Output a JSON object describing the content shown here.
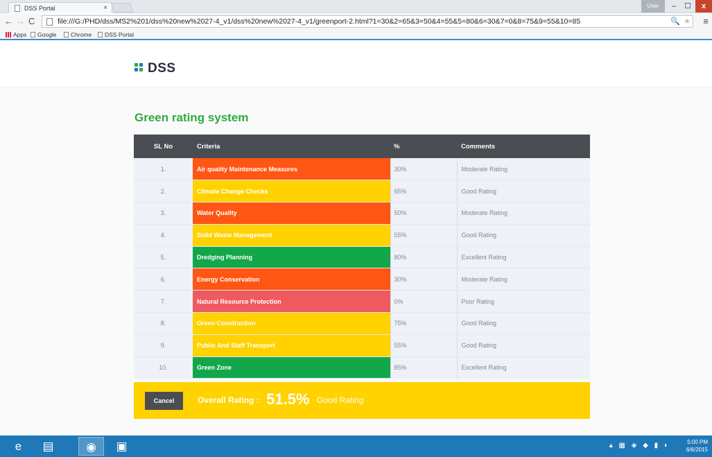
{
  "browser": {
    "tab_title": "DSS Portal",
    "tab_close": "×",
    "window_user": "User",
    "minimize": "–",
    "maximize": "☐",
    "close": "x",
    "back": "←",
    "forward": "→",
    "reload": "C",
    "url": "file:///G:/PHD/dss/MS2%201/dss%20new%2027-4_v1/dss%20new%2027-4_v1/greenport-2.html?1=30&2=65&3=50&4=55&5=80&6=30&7=0&8=75&9=55&10=85",
    "zoom_icon": "🔍",
    "star_icon": "★",
    "menu_icon": "≡",
    "bookmarks": [
      "Apps",
      "Google",
      "Chrome",
      "DSS Portal"
    ]
  },
  "header": {
    "logo_text": "DSS"
  },
  "page": {
    "title": "Green rating system"
  },
  "table": {
    "columns": [
      "SL No",
      "Criteria",
      "%",
      "Comments"
    ],
    "rows": [
      {
        "sl": "1.",
        "criteria": "Air quality Maintenance Measures",
        "percent": "30%",
        "comment": "Moderate Rating",
        "color": "#ff5614"
      },
      {
        "sl": "2.",
        "criteria": "Climate Change Checks",
        "percent": "65%",
        "comment": "Good Rating",
        "color": "#ffd200"
      },
      {
        "sl": "3.",
        "criteria": "Water Quality",
        "percent": "50%",
        "comment": "Moderate Rating",
        "color": "#ff5614"
      },
      {
        "sl": "4.",
        "criteria": "Solid Waste Management",
        "percent": "55%",
        "comment": "Good Rating",
        "color": "#ffd200"
      },
      {
        "sl": "5.",
        "criteria": "Dredging Planning",
        "percent": "80%",
        "comment": "Excellent Rating",
        "color": "#12a74a"
      },
      {
        "sl": "6.",
        "criteria": "Energy Conservation",
        "percent": "30%",
        "comment": "Moderate Rating",
        "color": "#ff5614"
      },
      {
        "sl": "7.",
        "criteria": "Natural Resource Protection",
        "percent": "0%",
        "comment": "Poor Rating",
        "color": "#ee5a5f"
      },
      {
        "sl": "8.",
        "criteria": "Green Construction",
        "percent": "75%",
        "comment": "Good Rating",
        "color": "#ffd200"
      },
      {
        "sl": "9.",
        "criteria": "Public And Staff Transport",
        "percent": "55%",
        "comment": "Good Rating",
        "color": "#ffd200"
      },
      {
        "sl": "10.",
        "criteria": "Green Zone",
        "percent": "85%",
        "comment": "Excellent Rating",
        "color": "#12a74a"
      }
    ]
  },
  "footer": {
    "cancel_label": "Cancel",
    "overall_label": "Overall Rating :",
    "overall_value": "51.5%",
    "overall_rating": "Good Rating"
  },
  "taskbar": {
    "items": [
      "ie-icon",
      "file-explorer-icon",
      "chrome-icon",
      "app-icon"
    ],
    "time": "5:00 PM",
    "date": "6/6/2015"
  },
  "colors": {
    "title_green": "#2faa3f",
    "header_dark": "#4a4d52",
    "footer_yellow": "#ffd200",
    "moderate_orange": "#ff5614",
    "good_yellow": "#ffd200",
    "excellent_green": "#12a74a",
    "poor_red": "#ee5a5f"
  }
}
